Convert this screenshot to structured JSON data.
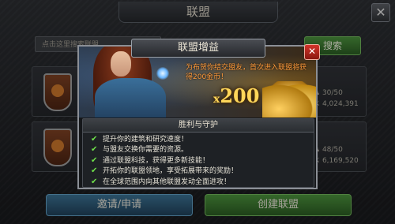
{
  "window": {
    "title": "联盟",
    "close_glyph": "✕"
  },
  "search": {
    "placeholder": "点击这里搜索联盟",
    "button_label": "搜索"
  },
  "alliances": [
    {
      "members": "30/50",
      "power": "4,024,391"
    },
    {
      "members": "48/50",
      "power": "6,169,520"
    }
  ],
  "bottom_buttons": {
    "invite_label": "邀请/申请",
    "create_label": "创建联盟"
  },
  "modal": {
    "title": "联盟增益",
    "close_glyph": "✕",
    "banner_text": "为布贺你结交盟友，首次进入联盟将获得200金币！",
    "reward_multiplier_prefix": "x",
    "reward_amount": "200",
    "section_title": "胜利与守护",
    "benefits": [
      "提升你的建筑和研究速度！",
      "与盟友交换你需要的资源。",
      "通过联盟科技，获得更多新技能！",
      "开拓你的联盟领地，享受拓展带来的奖励！",
      "在全球范围内向其他联盟发动全面进攻！"
    ],
    "check_glyph": "✔"
  },
  "colors": {
    "accent_green": "#4a8f3c",
    "accent_blue": "#3a6f8f",
    "close_red": "#d2352a",
    "banner_text": "#ff9a3a",
    "gold": "#ffd75a"
  },
  "icons": [
    "close-icon",
    "check-icon",
    "shield-icon",
    "members-icon",
    "power-icon"
  ]
}
